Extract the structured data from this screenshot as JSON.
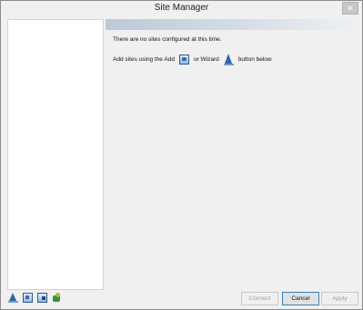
{
  "window": {
    "title": "Site Manager",
    "close_glyph": "✕"
  },
  "content": {
    "no_sites_text": "There are no sites configured at this time.",
    "hint_prefix": "Add sites using the Add",
    "hint_middle": "or Wizard",
    "hint_suffix": "button below",
    "add_icon": "add-site-icon",
    "wizard_icon": "wizard-icon"
  },
  "toolbar": {
    "icons": [
      "wizard-icon",
      "add-site-icon",
      "edit-site-icon",
      "import-sites-icon"
    ]
  },
  "buttons": {
    "connect": "Connect",
    "cancel": "Cancel",
    "apply": "Apply"
  },
  "colors": {
    "header_strip": "#bcc9d8",
    "window_bg": "#f0f0f0",
    "disabled_text": "#a0a0a0"
  }
}
